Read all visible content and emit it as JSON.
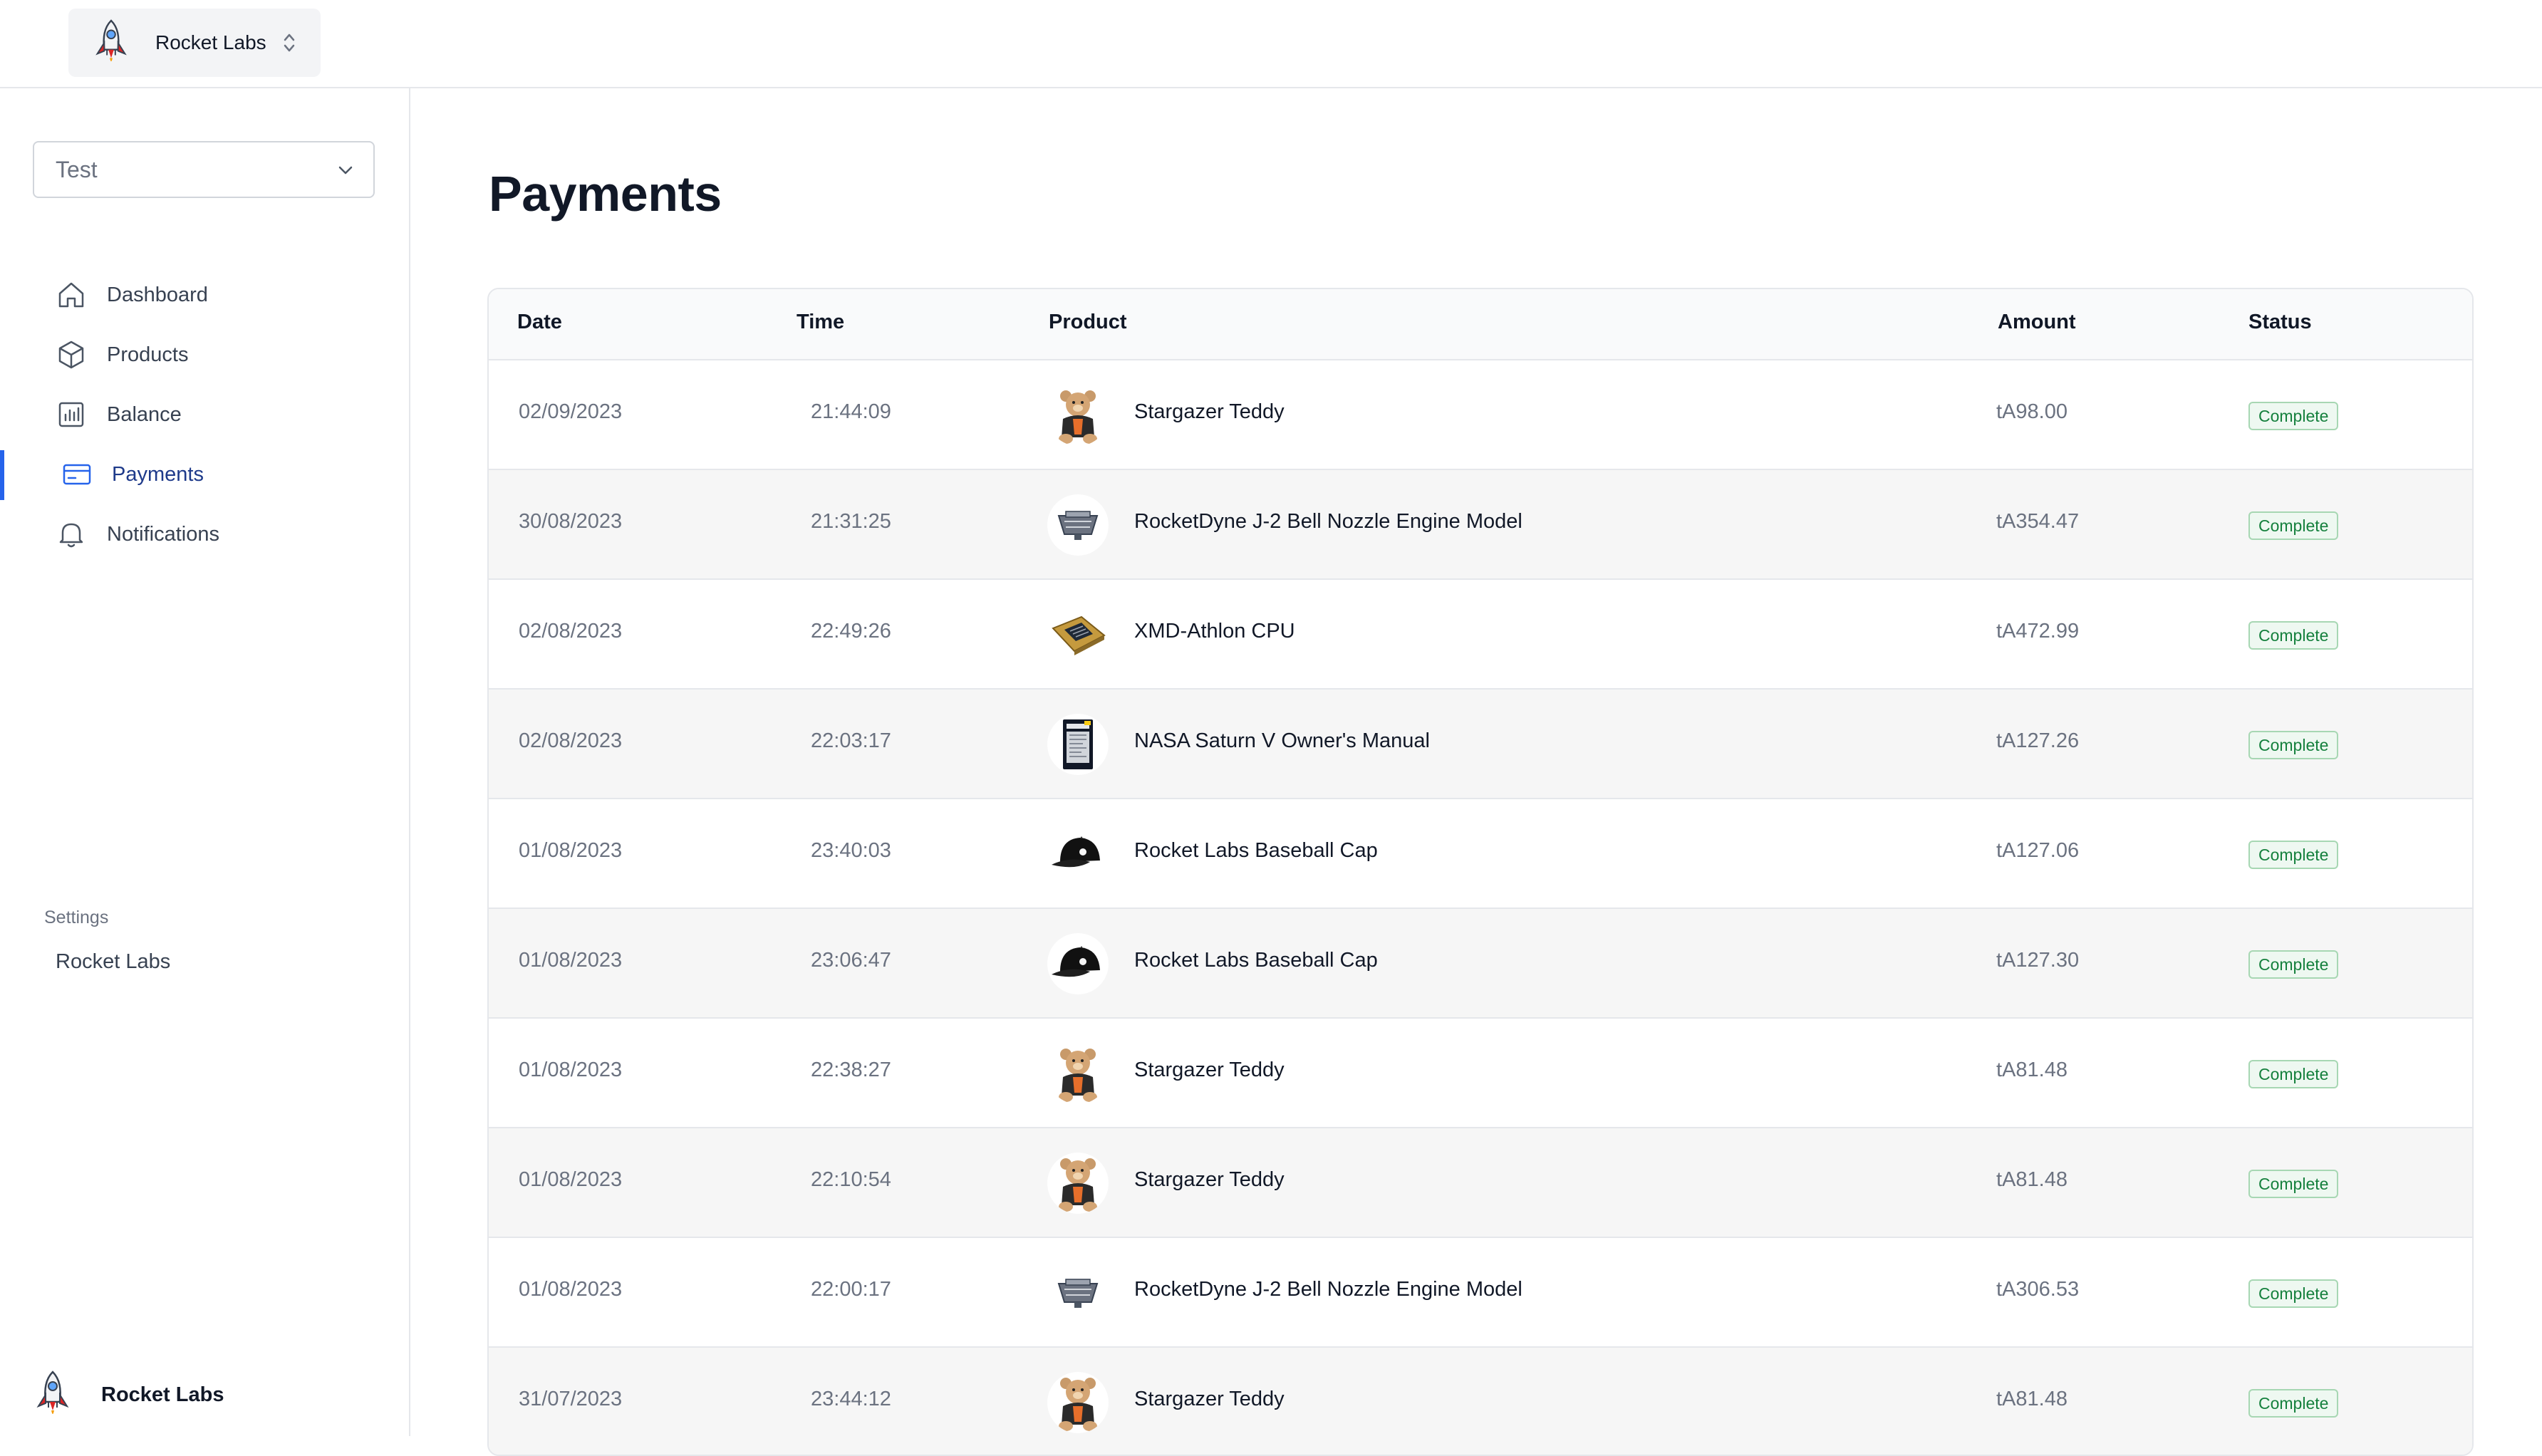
{
  "org": {
    "name": "Rocket Labs"
  },
  "sidebar": {
    "environment": "Test",
    "items": [
      {
        "label": "Dashboard",
        "icon": "home-icon"
      },
      {
        "label": "Products",
        "icon": "box-icon"
      },
      {
        "label": "Balance",
        "icon": "bar-chart-icon"
      },
      {
        "label": "Payments",
        "icon": "credit-card-icon",
        "active": true
      },
      {
        "label": "Notifications",
        "icon": "bell-icon"
      }
    ],
    "settings_heading": "Settings",
    "settings_link": "Rocket Labs",
    "footer_name": "Rocket Labs"
  },
  "main": {
    "title": "Payments"
  },
  "table": {
    "headers": {
      "date": "Date",
      "time": "Time",
      "product": "Product",
      "amount": "Amount",
      "status": "Status"
    },
    "rows": [
      {
        "date": "02/09/2023",
        "time": "21:44:09",
        "product": "Stargazer Teddy",
        "thumb": "teddy",
        "amount": "tA98.00",
        "status": "Complete"
      },
      {
        "date": "30/08/2023",
        "time": "21:31:25",
        "product": "RocketDyne J-2 Bell Nozzle Engine Model",
        "thumb": "engine",
        "amount": "tA354.47",
        "status": "Complete"
      },
      {
        "date": "02/08/2023",
        "time": "22:49:26",
        "product": "XMD-Athlon CPU",
        "thumb": "cpu",
        "amount": "tA472.99",
        "status": "Complete"
      },
      {
        "date": "02/08/2023",
        "time": "22:03:17",
        "product": "NASA Saturn V Owner's Manual",
        "thumb": "manual",
        "amount": "tA127.26",
        "status": "Complete"
      },
      {
        "date": "01/08/2023",
        "time": "23:40:03",
        "product": "Rocket Labs Baseball Cap",
        "thumb": "cap",
        "amount": "tA127.06",
        "status": "Complete"
      },
      {
        "date": "01/08/2023",
        "time": "23:06:47",
        "product": "Rocket Labs Baseball Cap",
        "thumb": "cap",
        "amount": "tA127.30",
        "status": "Complete"
      },
      {
        "date": "01/08/2023",
        "time": "22:38:27",
        "product": "Stargazer Teddy",
        "thumb": "teddy",
        "amount": "tA81.48",
        "status": "Complete"
      },
      {
        "date": "01/08/2023",
        "time": "22:10:54",
        "product": "Stargazer Teddy",
        "thumb": "teddy",
        "amount": "tA81.48",
        "status": "Complete"
      },
      {
        "date": "01/08/2023",
        "time": "22:00:17",
        "product": "RocketDyne J-2 Bell Nozzle Engine Model",
        "thumb": "engine",
        "amount": "tA306.53",
        "status": "Complete"
      },
      {
        "date": "31/07/2023",
        "time": "23:44:12",
        "product": "Stargazer Teddy",
        "thumb": "teddy",
        "amount": "tA81.48",
        "status": "Complete"
      }
    ]
  },
  "colors": {
    "accent": "#2563eb",
    "active_text": "#1e3a8a",
    "status_green": "#15803d"
  }
}
